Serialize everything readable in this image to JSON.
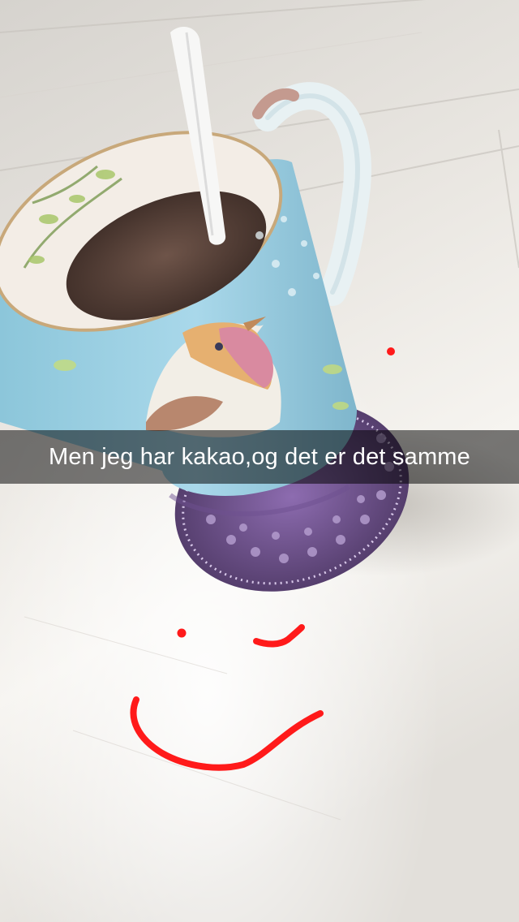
{
  "snap": {
    "caption": "Men jeg har kakao,og det er det samme",
    "drawing_color": "#ff1a1a"
  },
  "photo": {
    "subject_icon": "hot-cocoa-mug-icon",
    "mug_color": "#9fd3e6",
    "coaster_color": "#7a5a9c",
    "surface_color": "#ece9e4"
  }
}
